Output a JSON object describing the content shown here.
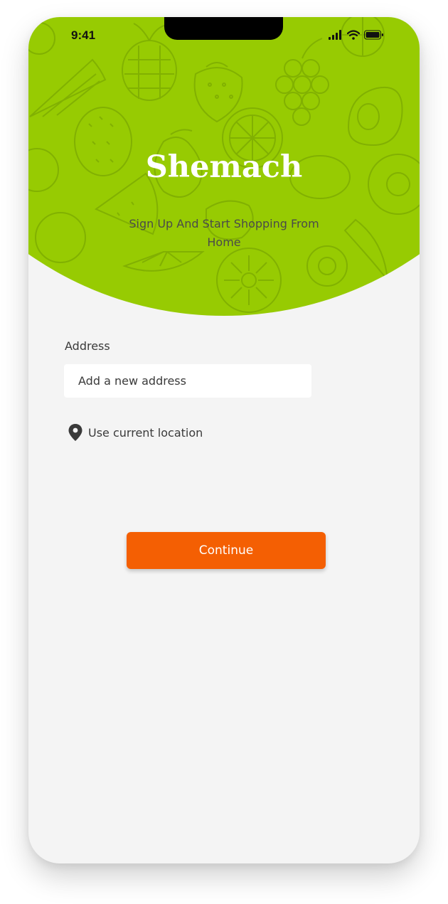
{
  "status_bar": {
    "time": "9:41",
    "icons": [
      "signal-icon",
      "wifi-icon",
      "battery-icon"
    ]
  },
  "header": {
    "title": "Shemach",
    "subtitle": "Sign Up And Start Shopping From Home",
    "background_color": "#97cb02",
    "pattern": "fruit-pattern"
  },
  "form": {
    "address_label": "Address",
    "address_placeholder": "Add a new address",
    "address_value": "",
    "location_icon": "location-pin-icon",
    "location_label": "Use current location"
  },
  "actions": {
    "continue_label": "Continue",
    "continue_color": "#f45f03"
  }
}
